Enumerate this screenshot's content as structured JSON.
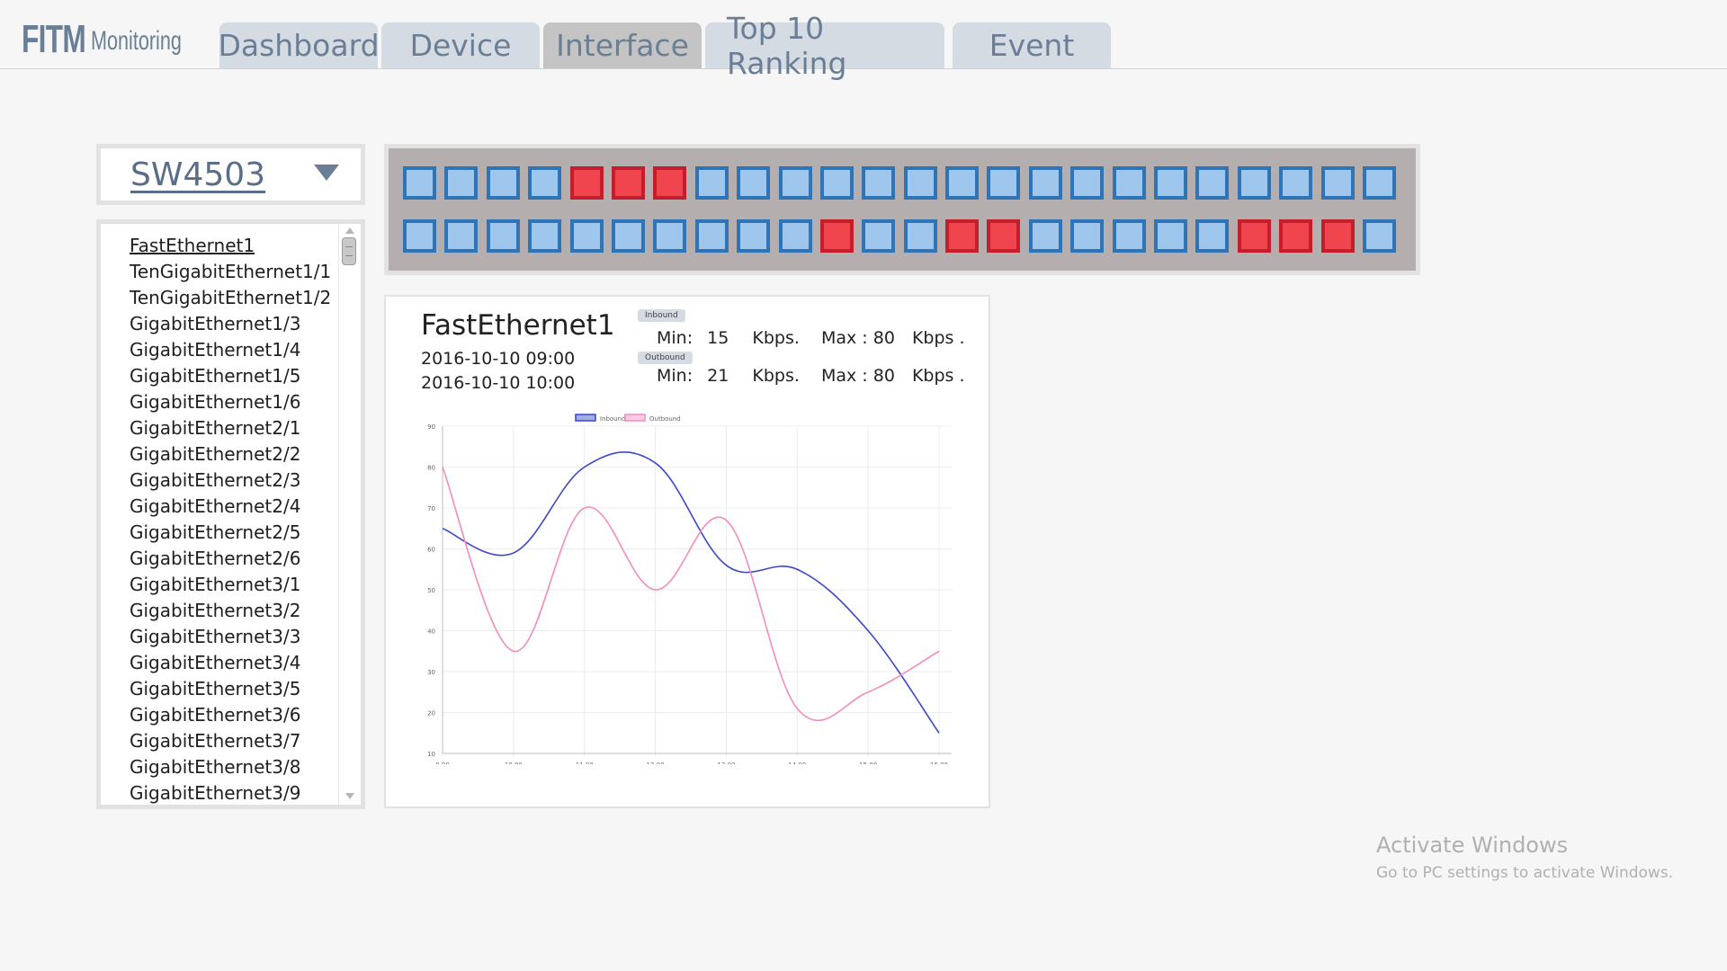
{
  "app": {
    "logo_main": "FITM",
    "logo_sub": "Monitoring"
  },
  "tabs": [
    {
      "label": "Dashboard",
      "active": false
    },
    {
      "label": "Device",
      "active": false
    },
    {
      "label": "Interface",
      "active": true
    },
    {
      "label": "Top 10 Ranking",
      "active": false
    },
    {
      "label": "Event",
      "active": false
    }
  ],
  "device_select": {
    "value": "SW4503",
    "icon": "dropdown-triangle-icon"
  },
  "interfaces": [
    "FastEthernet1",
    "TenGigabitEthernet1/1",
    "TenGigabitEthernet1/2",
    "GigabitEthernet1/3",
    "GigabitEthernet1/4",
    "GigabitEthernet1/5",
    "GigabitEthernet1/6",
    "GigabitEthernet2/1",
    "GigabitEthernet2/2",
    "GigabitEthernet2/3",
    "GigabitEthernet2/4",
    "GigabitEthernet2/5",
    "GigabitEthernet2/6",
    "GigabitEthernet3/1",
    "GigabitEthernet3/2",
    "GigabitEthernet3/3",
    "GigabitEthernet3/4",
    "GigabitEthernet3/5",
    "GigabitEthernet3/6",
    "GigabitEthernet3/7",
    "GigabitEthernet3/8",
    "GigabitEthernet3/9"
  ],
  "selected_interface_index": 0,
  "ports": {
    "colors": {
      "up_fill": "#9fc6ec",
      "up_border": "#2f74b7",
      "down_fill": "#f0454f",
      "down_border": "#c31e2b"
    },
    "row1": [
      "up",
      "up",
      "up",
      "up",
      "down",
      "down",
      "down",
      "up",
      "up",
      "up",
      "up",
      "up",
      "up",
      "up",
      "up",
      "up",
      "up",
      "up",
      "up",
      "up",
      "up",
      "up",
      "up",
      "up"
    ],
    "row2": [
      "up",
      "up",
      "up",
      "up",
      "up",
      "up",
      "up",
      "up",
      "up",
      "up",
      "down",
      "up",
      "up",
      "down",
      "down",
      "up",
      "up",
      "up",
      "up",
      "up",
      "down",
      "down",
      "down",
      "up"
    ]
  },
  "detail": {
    "interface": "FastEthernet1",
    "time_from": "2016-10-10 09:00",
    "time_to": "2016-10-10 10:00",
    "inbound": {
      "badge": "Inbound",
      "min_label": "Min:",
      "min": "15",
      "unit": "Kbps.",
      "max_label": "Max : 80",
      "max_unit": "Kbps ."
    },
    "outbound": {
      "badge": "Outbound",
      "min_label": "Min:",
      "min": "21",
      "unit": "Kbps.",
      "max_label": "Max : 80",
      "max_unit": "Kbps ."
    }
  },
  "chart_data": {
    "type": "line",
    "categories": [
      "9.00",
      "10.00",
      "11.00",
      "12.00",
      "13.00",
      "14.00",
      "15.00",
      "16.00"
    ],
    "series": [
      {
        "name": "Inbound",
        "color": "#3a47c9",
        "values": [
          65,
          59,
          80,
          81,
          56,
          55,
          40,
          15
        ]
      },
      {
        "name": "Outbound",
        "color": "#f28bbf",
        "values": [
          80,
          35,
          70,
          50,
          67,
          21,
          25,
          35
        ]
      }
    ],
    "ylim": [
      10,
      90
    ],
    "yticks": [
      "10",
      "20",
      "30",
      "40",
      "50",
      "60",
      "70",
      "80",
      "90"
    ],
    "grid": true,
    "legend": "top-center"
  },
  "watermark": {
    "title": "Activate Windows",
    "subtitle": "Go to PC settings to activate Windows."
  }
}
